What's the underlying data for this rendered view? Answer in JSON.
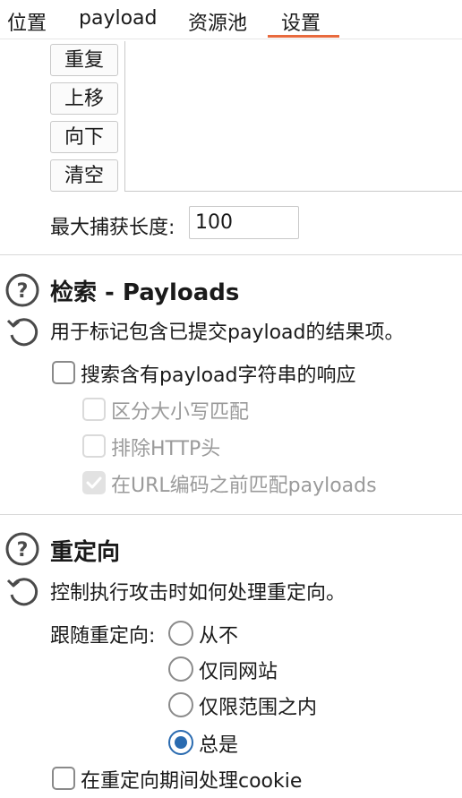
{
  "tabs": [
    {
      "label": "位置"
    },
    {
      "label": "payload"
    },
    {
      "label": "资源池"
    },
    {
      "label": "设置",
      "active": true
    }
  ],
  "list_buttons": {
    "repeat": "重复",
    "move_up": "上移",
    "move_down": "向下",
    "clear": "清空"
  },
  "max_capture": {
    "label": "最大捕获长度:",
    "value": "100"
  },
  "search_section": {
    "title": "检索 - Payloads",
    "description": "用于标记包含已提交payload的结果项。",
    "options": [
      {
        "label": "搜索含有payload字符串的响应",
        "checked": false,
        "enabled": true
      },
      {
        "label": "区分大小写匹配",
        "checked": false,
        "enabled": false
      },
      {
        "label": "排除HTTP头",
        "checked": false,
        "enabled": false
      },
      {
        "label": "在URL编码之前匹配payloads",
        "checked": true,
        "enabled": false
      }
    ]
  },
  "redirect_section": {
    "title": "重定向",
    "description": "控制执行攻击时如何处理重定向。",
    "follow_label": "跟随重定向:",
    "options": [
      {
        "label": "从不",
        "selected": false
      },
      {
        "label": "仅同网站",
        "selected": false
      },
      {
        "label": "仅限范围之内",
        "selected": false
      },
      {
        "label": "总是",
        "selected": true
      }
    ],
    "process_cookies_label": "在重定向期间处理cookie",
    "process_cookies_checked": false
  },
  "colors": {
    "tab_active_underline": "#e86a3e",
    "radio_accent": "#2a6bb0"
  }
}
